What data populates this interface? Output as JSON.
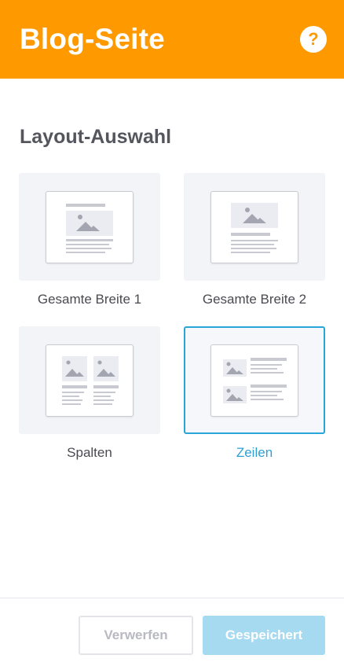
{
  "header": {
    "title": "Blog-Seite",
    "help_glyph": "?"
  },
  "layout_section": {
    "title": "Layout-Auswahl",
    "options": [
      {
        "label": "Gesamte Breite 1",
        "selected": false,
        "icon": "full-width-1-layout-icon"
      },
      {
        "label": "Gesamte Breite 2",
        "selected": false,
        "icon": "full-width-2-layout-icon"
      },
      {
        "label": "Spalten",
        "selected": false,
        "icon": "columns-layout-icon"
      },
      {
        "label": "Zeilen",
        "selected": true,
        "icon": "rows-layout-icon"
      }
    ]
  },
  "footer": {
    "discard_label": "Verwerfen",
    "save_label": "Gespeichert"
  },
  "colors": {
    "brand": "#ff9900",
    "accent": "#29a6d9",
    "save_disabled": "#a6daf1"
  }
}
